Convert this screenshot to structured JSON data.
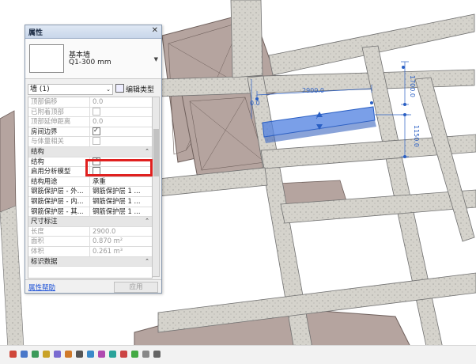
{
  "panel": {
    "title": "属性",
    "type_name_line1": "基本墙",
    "type_name_line2": "Q1-300 mm",
    "instance_selector": "墙 (1)",
    "edit_type_label": "编辑类型",
    "help_link": "属性帮助",
    "apply_button": "应用"
  },
  "properties": {
    "rows": [
      {
        "kind": "param",
        "label": "顶部偏移",
        "value": "0.0",
        "disabled": true
      },
      {
        "kind": "param",
        "label": "已附着顶部",
        "check": "off",
        "disabled": true
      },
      {
        "kind": "param",
        "label": "顶部延伸距离",
        "value": "0.0",
        "disabled": true
      },
      {
        "kind": "param",
        "label": "房间边界",
        "check": "on",
        "disabled": false
      },
      {
        "kind": "param",
        "label": "与体量相关",
        "check": "off",
        "disabled": true
      },
      {
        "kind": "category",
        "label": "结构"
      },
      {
        "kind": "param",
        "label": "结构",
        "check": "on",
        "disabled": false
      },
      {
        "kind": "param",
        "label": "启用分析模型",
        "check": "off",
        "disabled": false
      },
      {
        "kind": "param",
        "label": "结构用途",
        "value": "承重",
        "disabled": false
      },
      {
        "kind": "param",
        "label": "钢筋保护层 - 外...",
        "value": "钢筋保护层 1 ...",
        "disabled": false
      },
      {
        "kind": "param",
        "label": "钢筋保护层 - 内...",
        "value": "钢筋保护层 1 ...",
        "disabled": false
      },
      {
        "kind": "param",
        "label": "钢筋保护层 - 其...",
        "value": "钢筋保护层 1 ...",
        "disabled": false
      },
      {
        "kind": "category",
        "label": "尺寸标注"
      },
      {
        "kind": "param",
        "label": "长度",
        "value": "2900.0",
        "disabled": true
      },
      {
        "kind": "param",
        "label": "面积",
        "value": "0.870 m²",
        "disabled": true
      },
      {
        "kind": "param",
        "label": "体积",
        "value": "0.261 m³",
        "disabled": true
      },
      {
        "kind": "category",
        "label": "标识数据"
      }
    ]
  },
  "viewport": {
    "dim_top": "2900.0",
    "dim_right_top": "1700.0",
    "dim_right": "1150.0",
    "dim_left": "0.0"
  },
  "colors": {
    "slab": "#b5a49f",
    "slab_edge": "#6f605c",
    "beam": "#d4d2cb",
    "beam_edge": "#707070",
    "selected_wall": "#4d7fe0",
    "dimension": "#2a5fc4",
    "highlight": "#e0201f"
  },
  "statusbar": {
    "icons": [
      "scale-icon",
      "detail-level-icon",
      "visual-style-icon",
      "sun-path-icon",
      "shadows-icon",
      "render-icon",
      "crop-icon",
      "show-crop-icon",
      "unlock-3d-icon",
      "temp-hide-icon",
      "reveal-hidden-icon",
      "analytical-model-icon",
      "highlight-boundaries-icon",
      "expand-icon"
    ]
  }
}
